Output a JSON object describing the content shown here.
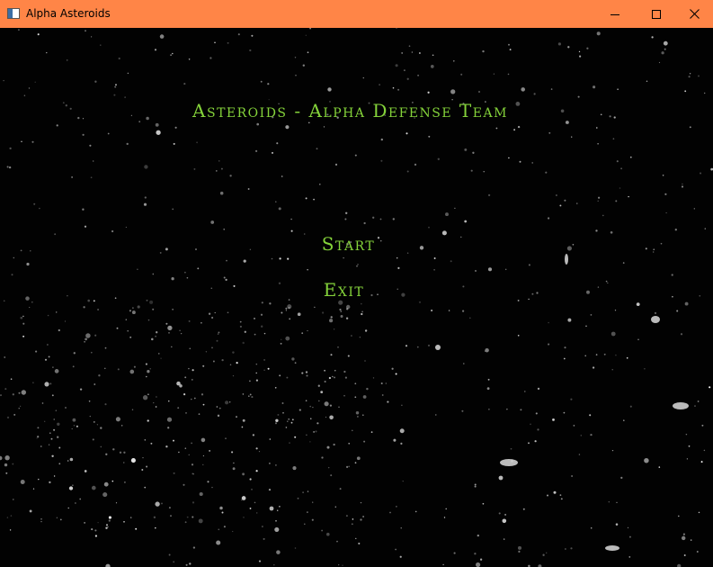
{
  "window": {
    "title": "Alpha Asteroids",
    "titlebar_color": "#ff8547",
    "controls": [
      "minimize-icon",
      "maximize-icon",
      "close-icon"
    ]
  },
  "game": {
    "title": "Asteroids - Alpha Defense Team",
    "text_color": "#84d23a",
    "background": "starfield",
    "menu": {
      "start_label": "Start",
      "exit_label": "Exit"
    }
  }
}
